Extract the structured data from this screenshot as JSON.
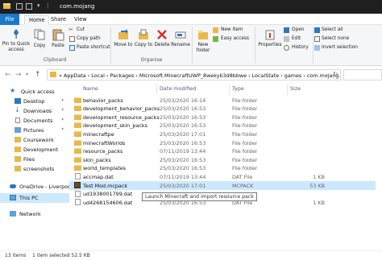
{
  "titlebar": {
    "title": "com.mojang"
  },
  "ribbon_tabs": [
    {
      "label": "File"
    },
    {
      "label": "Home"
    },
    {
      "label": "Share"
    },
    {
      "label": "View"
    }
  ],
  "ribbon": {
    "clipboard": {
      "pin_label": "Pin to Quick access",
      "copy_label": "Copy",
      "paste_label": "Paste",
      "cut_label": "Cut",
      "copy_path_label": "Copy path",
      "paste_shortcut_label": "Paste shortcut",
      "group_label": "Clipboard"
    },
    "organise": {
      "move_to_label": "Move to",
      "copy_to_label": "Copy to",
      "delete_label": "Delete",
      "rename_label": "Rename",
      "group_label": "Organise"
    },
    "new": {
      "new_folder_label": "New folder",
      "new_item_label": "New item",
      "easy_access_label": "Easy access"
    },
    "open": {
      "properties_label": "Properties",
      "open_label": "Open",
      "edit_label": "Edit",
      "history_label": "History"
    },
    "select": {
      "select_all_label": "Select all",
      "select_none_label": "Select none",
      "invert_label": "Invert selection"
    }
  },
  "address": {
    "crumbs": "« AppData  ›  Local  ›  Packages  ›  Microsoft.MinecraftUWP_8wekyb3d8bbwe  ›  LocalState  ›  games  ›  com.mojang"
  },
  "nav": {
    "items": [
      {
        "label": "Quick access"
      },
      {
        "label": "Desktop"
      },
      {
        "label": "Downloads"
      },
      {
        "label": "Documents"
      },
      {
        "label": "Pictures"
      },
      {
        "label": "Coursework"
      },
      {
        "label": "Development"
      },
      {
        "label": "Files"
      },
      {
        "label": "screenshots"
      },
      {
        "label": "OneDrive - Liverpool"
      },
      {
        "label": "This PC"
      },
      {
        "label": "Network"
      }
    ]
  },
  "columns": {
    "name": "Name",
    "date": "Date modified",
    "type": "Type",
    "size": "Size"
  },
  "files": [
    {
      "name": "behavior_packs",
      "date": "25/03/2020 16:14",
      "type": "File folder",
      "size": "",
      "kind": "folder"
    },
    {
      "name": "development_behavior_packs",
      "date": "25/03/2020 16:53",
      "type": "File folder",
      "size": "",
      "kind": "folder"
    },
    {
      "name": "development_resource_packs",
      "date": "25/03/2020 16:53",
      "type": "File folder",
      "size": "",
      "kind": "folder"
    },
    {
      "name": "development_skin_packs",
      "date": "25/03/2020 16:53",
      "type": "File folder",
      "size": "",
      "kind": "folder"
    },
    {
      "name": "minecraftpe",
      "date": "25/03/2020 17:01",
      "type": "File folder",
      "size": "",
      "kind": "folder"
    },
    {
      "name": "minecraftWorlds",
      "date": "25/03/2020 16:53",
      "type": "File folder",
      "size": "",
      "kind": "folder"
    },
    {
      "name": "resource_packs",
      "date": "07/11/2019 13:44",
      "type": "File folder",
      "size": "",
      "kind": "folder"
    },
    {
      "name": "skin_packs",
      "date": "25/03/2020 16:53",
      "type": "File folder",
      "size": "",
      "kind": "folder"
    },
    {
      "name": "world_templates",
      "date": "25/03/2020 16:53",
      "type": "File folder",
      "size": "",
      "kind": "folder"
    },
    {
      "name": "accmap.dat",
      "date": "07/11/2019 13:44",
      "type": "DAT File",
      "size": "1 KB",
      "kind": "doc"
    },
    {
      "name": "Test Mod.mcpack",
      "date": "25/03/2020 17:01",
      "type": "MCPACK",
      "size": "53 KB",
      "kind": "pack"
    },
    {
      "name": "ud1938001799.dat",
      "date": "",
      "type": "",
      "size": "",
      "kind": "doc"
    },
    {
      "name": "ud4268154606.dat",
      "date": "25/03/2020 16:53",
      "type": "DAT File",
      "size": "1 KB",
      "kind": "doc"
    }
  ],
  "tooltip": "Launch Minecraft and import resource pack",
  "status": {
    "items": "13 items",
    "selected": "1 item selected  52.5 KB"
  }
}
